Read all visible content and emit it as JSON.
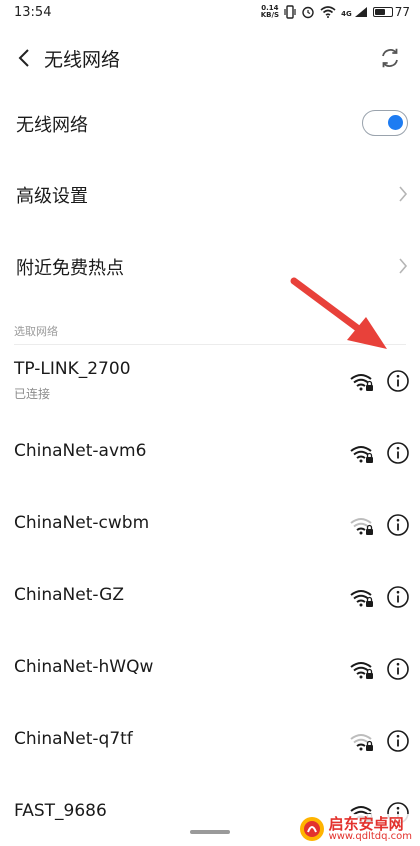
{
  "status_bar": {
    "time": "13:54",
    "net_speed_value": "0.14",
    "net_speed_unit": "KB/S",
    "signal_label": "4G",
    "battery_percent": "77",
    "battery_level": 0.77
  },
  "app_bar": {
    "title": "无线网络"
  },
  "settings": {
    "wifi_toggle_label": "无线网络",
    "wifi_enabled": true,
    "advanced_label": "高级设置",
    "hotspots_label": "附近免费热点"
  },
  "networks_section": {
    "label": "选取网络",
    "items": [
      {
        "name": "TP-LINK_2700",
        "status": "已连接",
        "signal": "strong",
        "locked": true
      },
      {
        "name": "ChinaNet-avm6",
        "signal": "strong",
        "locked": true
      },
      {
        "name": "ChinaNet-cwbm",
        "signal": "weak",
        "locked": true
      },
      {
        "name": "ChinaNet-GZ",
        "signal": "strong",
        "locked": true
      },
      {
        "name": "ChinaNet-hWQw",
        "signal": "strong",
        "locked": true
      },
      {
        "name": "ChinaNet-q7tf",
        "signal": "weak",
        "locked": true
      },
      {
        "name": "FAST_9686",
        "signal": "strong",
        "locked": true
      }
    ]
  },
  "watermark": {
    "name": "启东安卓网",
    "url": "www.qdltdq.com"
  },
  "colors": {
    "accent": "#1e7cf2",
    "annotation_arrow": "#e8413a",
    "watermark": "#e3322d"
  }
}
